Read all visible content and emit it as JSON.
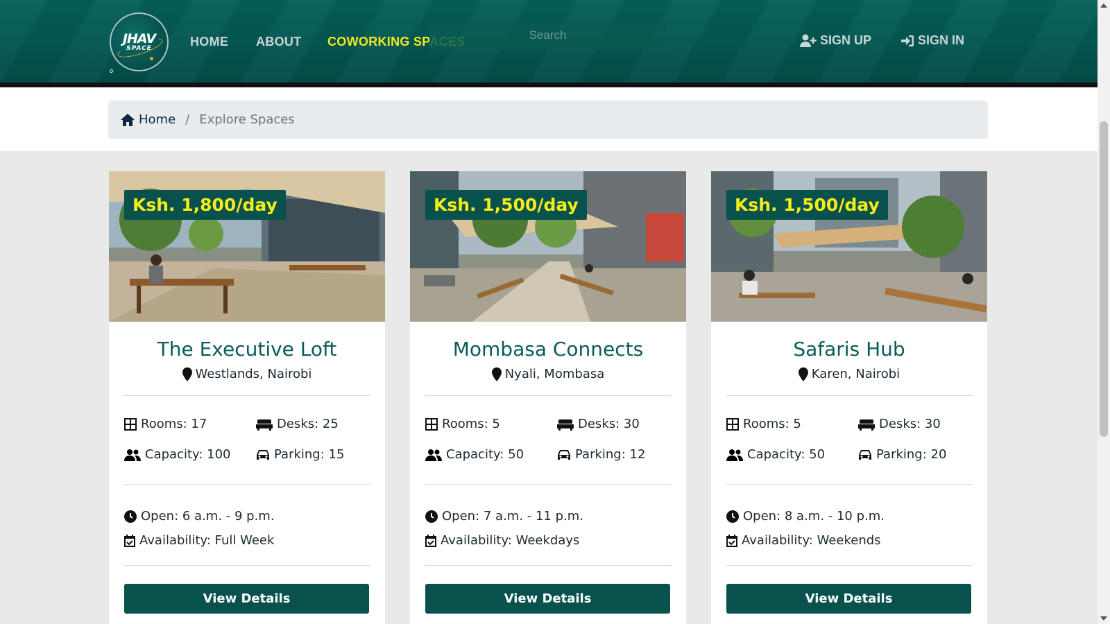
{
  "nav": {
    "logo_line1": "JHAV",
    "logo_line2": "SPACE",
    "links": [
      "HOME",
      "ABOUT",
      "COWORKING SPACES"
    ],
    "active": "COWORKING SPACES",
    "search_placeholder": "Search",
    "signup": "SIGN UP",
    "signin": "SIGN IN"
  },
  "breadcrumb": {
    "home": "Home",
    "separator": "/",
    "current": "Explore Spaces"
  },
  "cards": [
    {
      "price": "Ksh. 1,800/day",
      "title": "The Executive Loft",
      "location": "Westlands, Nairobi",
      "rooms": "Rooms: 17",
      "desks": "Desks: 25",
      "capacity": "Capacity: 100",
      "parking": "Parking: 15",
      "open": "Open: 6 a.m. - 9 p.m.",
      "availability": "Availability: Full Week",
      "button": "View Details"
    },
    {
      "price": "Ksh. 1,500/day",
      "title": "Mombasa Connects",
      "location": "Nyali, Mombasa",
      "rooms": "Rooms: 5",
      "desks": "Desks: 30",
      "capacity": "Capacity: 50",
      "parking": "Parking: 12",
      "open": "Open: 7 a.m. - 11 p.m.",
      "availability": "Availability: Weekdays",
      "button": "View Details"
    },
    {
      "price": "Ksh. 1,500/day",
      "title": "Safaris Hub",
      "location": "Karen, Nairobi",
      "rooms": "Rooms: 5",
      "desks": "Desks: 30",
      "capacity": "Capacity: 50",
      "parking": "Parking: 20",
      "open": "Open: 8 a.m. - 10 p.m.",
      "availability": "Availability: Weekends",
      "button": "View Details"
    }
  ],
  "colors": {
    "brand": "#08514c",
    "accent": "#f2ea1c",
    "title": "#0a5c57"
  }
}
